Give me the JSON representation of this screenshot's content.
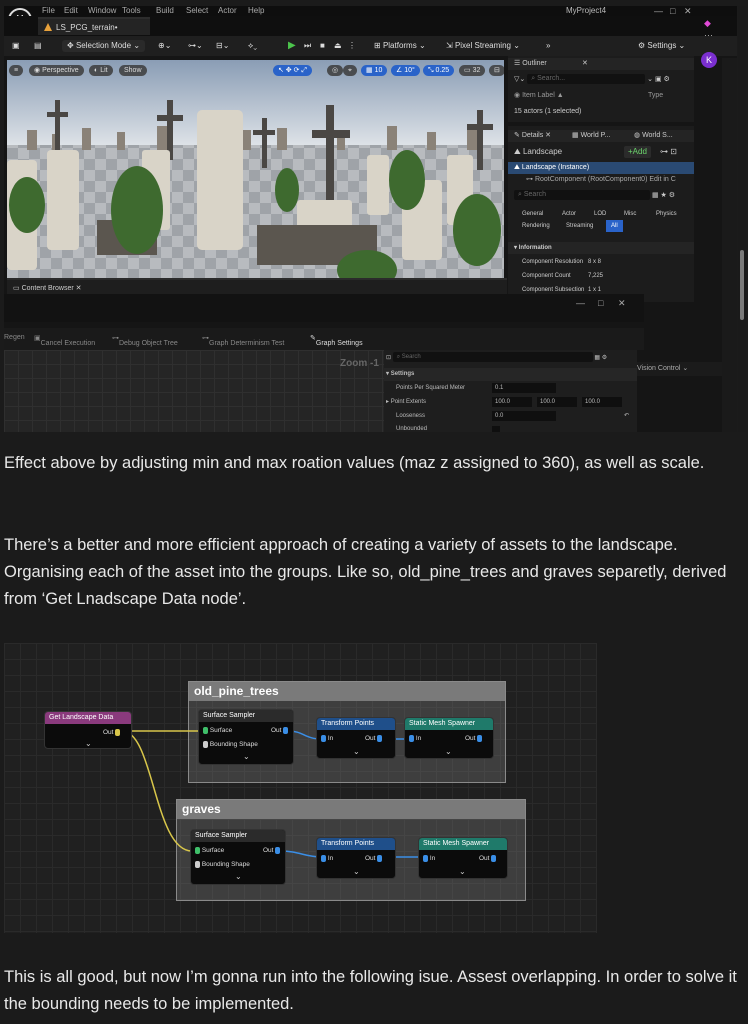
{
  "editor": {
    "menu": [
      "File",
      "Edit",
      "Window",
      "Tools",
      "Build",
      "Select",
      "Actor",
      "Help"
    ],
    "project_tab": "LS_PCG_terrain•",
    "project_name": "MyProject4",
    "toolbar": {
      "mode": "Selection Mode",
      "platforms": "Platforms",
      "pixel_streaming": "Pixel Streaming",
      "settings": "Settings"
    },
    "avatar": "K",
    "viewport": {
      "perspective": "Perspective",
      "lit": "Lit",
      "show": "Show",
      "grid": "10",
      "angle": "10°",
      "scale": "0.25",
      "cam_speed": "32"
    },
    "outliner": {
      "title": "Outliner",
      "search_placeholder": "Search...",
      "col_label": "Item Label ▲",
      "col_type": "Type",
      "count": "15 actors (1 selected)"
    },
    "details": {
      "tab_details": "Details",
      "tab_world_p": "World P...",
      "tab_world_s": "World S...",
      "actor": "Landscape",
      "add": "+Add",
      "instance": "Landscape (Instance)",
      "component": "RootComponent (RootComponent0)",
      "edit": "Edit in C",
      "search_placeholder": "Search",
      "filters": [
        "General",
        "Actor",
        "LOD",
        "Misc",
        "Physics",
        "Rendering",
        "Streaming",
        "All"
      ],
      "section": "Information",
      "props": [
        {
          "k": "Component Resolution",
          "v": "8 x 8"
        },
        {
          "k": "Component Count",
          "v": "7,225"
        },
        {
          "k": "Component Subsection",
          "v": "1 x 1"
        }
      ]
    },
    "content_browser": "Content Browser",
    "pcg_tools": [
      "Regen",
      "Cancel Execution",
      "Debug Object Tree",
      "Graph Determinism Test",
      "Graph Settings"
    ],
    "zoom": "Zoom -1",
    "pcg_details": {
      "search_placeholder": "Search",
      "section": "Settings",
      "rows": [
        {
          "k": "Points Per Squared Meter",
          "v": [
            "0.1"
          ]
        },
        {
          "k": "Point Extents",
          "v": [
            "100.0",
            "100.0",
            "100.0"
          ]
        },
        {
          "k": "Looseness",
          "v": [
            "0.0"
          ]
        },
        {
          "k": "Unbounded",
          "v": []
        }
      ]
    },
    "vision_control": "Vision Control"
  },
  "paragraph1": "Effect above by adjusting min and max roation values (maz z assigned to 360), as well as scale.",
  "paragraph2": "There’s a better and more efficient approach of creating a variety of assets to the landscape. Organising each of the asset into the groups. Like so, old_pine_trees and graves separetly, derived from ‘Get Lnadscape Data node’.",
  "paragraph3": "This is all good, but now I’m gonna run into the following isue. Assest overlapping. In order to solve it the bounding needs to be implemented.",
  "graph": {
    "group1": "old_pine_trees",
    "group2": "graves",
    "get_landscape": "Get Landscape Data",
    "out": "Out",
    "in": "In",
    "surface_sampler": "Surface Sampler",
    "surface": "Surface",
    "bounding_shape": "Bounding Shape",
    "transform_points": "Transform Points",
    "static_mesh_spawner": "Static Mesh Spawner"
  },
  "colors": {
    "accent_blue": "#2a63c9",
    "get_landscape_header": "#8a3a7d",
    "sampler_header": "#2b2b2b",
    "transform_header": "#1f4f8a",
    "spawner_header": "#1f7a6a",
    "wire_yellow": "#d8c64a",
    "wire_blue": "#3a8ee6"
  }
}
